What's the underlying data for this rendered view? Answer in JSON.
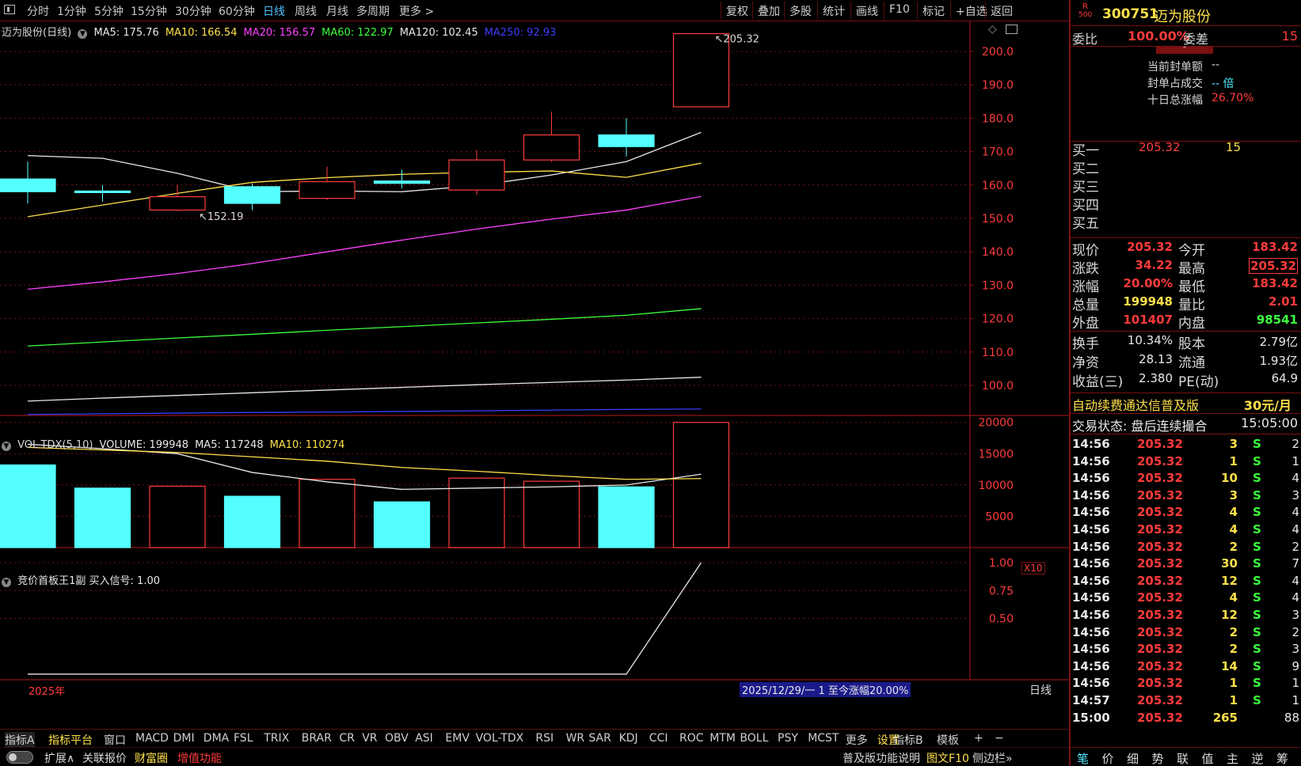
{
  "toolbar": {
    "periods": [
      "分时",
      "1分钟",
      "5分钟",
      "15分钟",
      "30分钟",
      "60分钟",
      "日线",
      "周线",
      "月线",
      "多周期",
      "更多 >"
    ],
    "active_period": "日线",
    "right_buttons": [
      "复权",
      "叠加",
      "多股",
      "统计",
      "画线",
      "F10",
      "标记",
      "+自选",
      "返回"
    ]
  },
  "main_panel": {
    "title": "迈为股份(日线)",
    "ma_legend": [
      {
        "label": "MA5: 175.76",
        "color": "#e8e8e8"
      },
      {
        "label": "MA10: 166.54",
        "color": "#ffe04a"
      },
      {
        "label": "MA20: 156.57",
        "color": "#ff40ff"
      },
      {
        "label": "MA60: 122.97",
        "color": "#3cff3c"
      },
      {
        "label": "MA120: 102.45",
        "color": "#e8e8e8"
      },
      {
        "label": "MA250: 92.93",
        "color": "#3c3cff"
      }
    ],
    "high_label": "205.32",
    "low_label": "152.19"
  },
  "volume_panel": {
    "legend": [
      {
        "label": "VOL-TDX(5,10)",
        "color": "#d8d8d8"
      },
      {
        "label": "VOLUME: 199948",
        "color": "#e8e8e8"
      },
      {
        "label": "MA5: 117248",
        "color": "#e8e8e8"
      },
      {
        "label": "MA10: 110274",
        "color": "#ffe04a"
      }
    ],
    "unit_label": "X10"
  },
  "indicator_panel": {
    "legend": "竞价首板王1副  买入信号: 1.00"
  },
  "axis": {
    "year_label": "2025年",
    "info_bar": "2025/12/29/一 1 至今涨幅20.00%",
    "period_right": "日线"
  },
  "chart_data": [
    {
      "type": "candlestick",
      "y_ticks": [
        100,
        110,
        120,
        130,
        140,
        150,
        160,
        170,
        180,
        190,
        200
      ],
      "ylim": [
        91,
        209
      ],
      "candles": [
        {
          "o": 161.8,
          "h": 167.0,
          "l": 154.5,
          "c": 158.0,
          "up": false
        },
        {
          "o": 158.2,
          "h": 160.0,
          "l": 155.0,
          "c": 157.8,
          "up": false
        },
        {
          "o": 152.5,
          "h": 160.0,
          "l": 152.2,
          "c": 156.5,
          "up": true
        },
        {
          "o": 159.5,
          "h": 160.5,
          "l": 152.5,
          "c": 154.5,
          "up": false
        },
        {
          "o": 156.0,
          "h": 165.5,
          "l": 155.5,
          "c": 161.0,
          "up": true
        },
        {
          "o": 161.2,
          "h": 164.5,
          "l": 159.0,
          "c": 160.5,
          "up": false
        },
        {
          "o": 158.5,
          "h": 170.5,
          "l": 157.0,
          "c": 167.5,
          "up": true
        },
        {
          "o": 167.5,
          "h": 182.0,
          "l": 167.0,
          "c": 175.0,
          "up": true
        },
        {
          "o": 175.0,
          "h": 180.0,
          "l": 168.5,
          "c": 171.5,
          "up": false
        },
        {
          "o": 183.42,
          "h": 205.32,
          "l": 183.42,
          "c": 205.32,
          "up": true
        }
      ],
      "ma_lines": [
        {
          "name": "MA5",
          "color": "#e8e8e8",
          "values": [
            168.8,
            168.0,
            163.5,
            158.0,
            158.2,
            158.0,
            159.8,
            163.0,
            167.0,
            175.76
          ]
        },
        {
          "name": "MA10",
          "color": "#ffe04a",
          "values": [
            150.5,
            154.0,
            157.5,
            160.8,
            162.2,
            163.2,
            163.8,
            164.2,
            162.3,
            166.54
          ]
        },
        {
          "name": "MA20",
          "color": "#ff40ff",
          "values": [
            128.8,
            131.0,
            133.5,
            136.5,
            140.0,
            143.5,
            146.8,
            149.8,
            152.5,
            156.57
          ]
        },
        {
          "name": "MA60",
          "color": "#3cff3c",
          "values": [
            111.8,
            113.0,
            114.2,
            115.3,
            116.5,
            117.6,
            118.7,
            119.8,
            121.0,
            122.97
          ]
        },
        {
          "name": "MA120",
          "color": "#e8e8e8",
          "values": [
            95.3,
            96.2,
            97.0,
            97.8,
            98.6,
            99.4,
            100.2,
            100.9,
            101.6,
            102.45
          ]
        },
        {
          "name": "MA250",
          "color": "#3c3cff",
          "values": [
            91.3,
            91.5,
            91.7,
            91.9,
            92.0,
            92.2,
            92.4,
            92.6,
            92.8,
            92.93
          ]
        }
      ]
    },
    {
      "type": "bar",
      "y_ticks": [
        5000,
        10000,
        15000,
        20000
      ],
      "ylim": [
        0,
        20600
      ],
      "values": [
        13200,
        9500,
        9800,
        8200,
        10900,
        7300,
        11100,
        10600,
        9700,
        19995
      ],
      "up": [
        false,
        false,
        true,
        false,
        true,
        false,
        true,
        true,
        false,
        true
      ],
      "ma5": [
        16500,
        15800,
        15000,
        12000,
        10500,
        9300,
        9500,
        9700,
        10000,
        11724
      ],
      "ma10": [
        16000,
        15600,
        15200,
        14500,
        13800,
        12800,
        12200,
        11500,
        10900,
        11027
      ]
    },
    {
      "type": "line",
      "y_ticks": [
        0.5,
        0.75,
        1.0
      ],
      "ylim": [
        -0.05,
        1.05
      ],
      "values": [
        0,
        0,
        0,
        0,
        0,
        0,
        0,
        0,
        0,
        1.0
      ]
    }
  ],
  "quote": {
    "badge_top": "R",
    "badge_bottom": "500",
    "code": "300751",
    "name": "迈为股份",
    "weibi_label": "委比",
    "weibi_value": "100.00%",
    "weicha_label": "委差",
    "weicha_value": "15",
    "seal_amount_label": "当前封单额",
    "seal_amount_value": "--",
    "seal_ratio_label": "封单占成交",
    "seal_ratio_value": "-- 倍",
    "ten_day_label": "十日总涨幅",
    "ten_day_value": "26.70%",
    "bids": [
      {
        "label": "买一",
        "price": "205.32",
        "vol": "15"
      },
      {
        "label": "买二",
        "price": "",
        "vol": ""
      },
      {
        "label": "买三",
        "price": "",
        "vol": ""
      },
      {
        "label": "买四",
        "price": "",
        "vol": ""
      },
      {
        "label": "买五",
        "price": "",
        "vol": ""
      }
    ],
    "stats": [
      {
        "l1": "现价",
        "v1": "205.32",
        "c1": "red",
        "l2": "今开",
        "v2": "183.42",
        "c2": "red"
      },
      {
        "l1": "涨跌",
        "v1": "34.22",
        "c1": "red",
        "l2": "最高",
        "v2": "205.32",
        "c2": "red"
      },
      {
        "l1": "涨幅",
        "v1": "20.00%",
        "c1": "red",
        "l2": "最低",
        "v2": "183.42",
        "c2": "red"
      },
      {
        "l1": "总量",
        "v1": "199948",
        "c1": "yel",
        "l2": "量比",
        "v2": "2.01",
        "c2": "red"
      },
      {
        "l1": "外盘",
        "v1": "101407",
        "c1": "red",
        "l2": "内盘",
        "v2": "98541",
        "c2": "grn"
      }
    ],
    "stats2": [
      {
        "l1": "换手",
        "v1": "10.34%",
        "l2": "股本",
        "v2": "2.79亿"
      },
      {
        "l1": "净资",
        "v1": "28.13",
        "l2": "流通",
        "v2": "1.93亿"
      },
      {
        "l1": "收益(三)",
        "v1": "2.380",
        "l2": "PE(动)",
        "v2": "64.9"
      }
    ],
    "ad_text": "自动续费通达信普及版",
    "ad_price": "30元/月",
    "status_label": "交易状态: 盘后连续撮合",
    "status_time": "15:05:00"
  },
  "ticks": [
    {
      "t": "14:56",
      "p": "205.32",
      "v": "3",
      "s": "S",
      "n": "2"
    },
    {
      "t": "14:56",
      "p": "205.32",
      "v": "1",
      "s": "S",
      "n": "1"
    },
    {
      "t": "14:56",
      "p": "205.32",
      "v": "10",
      "s": "S",
      "n": "4"
    },
    {
      "t": "14:56",
      "p": "205.32",
      "v": "3",
      "s": "S",
      "n": "3"
    },
    {
      "t": "14:56",
      "p": "205.32",
      "v": "4",
      "s": "S",
      "n": "4"
    },
    {
      "t": "14:56",
      "p": "205.32",
      "v": "4",
      "s": "S",
      "n": "4"
    },
    {
      "t": "14:56",
      "p": "205.32",
      "v": "2",
      "s": "S",
      "n": "2"
    },
    {
      "t": "14:56",
      "p": "205.32",
      "v": "30",
      "s": "S",
      "n": "7"
    },
    {
      "t": "14:56",
      "p": "205.32",
      "v": "12",
      "s": "S",
      "n": "4"
    },
    {
      "t": "14:56",
      "p": "205.32",
      "v": "4",
      "s": "S",
      "n": "4"
    },
    {
      "t": "14:56",
      "p": "205.32",
      "v": "12",
      "s": "S",
      "n": "3"
    },
    {
      "t": "14:56",
      "p": "205.32",
      "v": "2",
      "s": "S",
      "n": "2"
    },
    {
      "t": "14:56",
      "p": "205.32",
      "v": "2",
      "s": "S",
      "n": "3"
    },
    {
      "t": "14:56",
      "p": "205.32",
      "v": "14",
      "s": "S",
      "n": "9"
    },
    {
      "t": "14:56",
      "p": "205.32",
      "v": "1",
      "s": "S",
      "n": "1"
    },
    {
      "t": "14:57",
      "p": "205.32",
      "v": "1",
      "s": "S",
      "n": "1"
    },
    {
      "t": "15:00",
      "p": "205.32",
      "v": "265",
      "s": "",
      "n": "88"
    }
  ],
  "indicator_tabs": [
    "指标A",
    "指标平台",
    "窗口",
    "MACD",
    "DMI",
    "DMA",
    "FSL",
    "TRIX",
    "BRAR",
    "CR",
    "VR",
    "OBV",
    "ASI",
    "EMV",
    "VOL-TDX",
    "RSI",
    "WR",
    "SAR",
    "KDJ",
    "CCI",
    "ROC",
    "MTM",
    "BOLL",
    "PSY",
    "MCST",
    "更多",
    "设置",
    "指标B",
    "模板",
    "+",
    "−"
  ],
  "bottom_tabs": [
    {
      "label": "扩展∧",
      "color": "#d8d8d8"
    },
    {
      "label": "关联报价",
      "color": "#d8d8d8"
    },
    {
      "label": "财富圈",
      "color": "#ffe04a"
    },
    {
      "label": "增值功能",
      "color": "#ff3b3b"
    }
  ],
  "bottom_right_tabs": [
    {
      "label": "普及版功能说明",
      "color": "#d8d8d8"
    },
    {
      "label": "图文F10",
      "color": "#ffe04a"
    },
    {
      "label": "侧边栏»",
      "color": "#d8d8d8"
    }
  ],
  "rp_tabs": [
    "笔",
    "价",
    "细",
    "势",
    "联",
    "值",
    "主",
    "逆",
    "筹"
  ]
}
